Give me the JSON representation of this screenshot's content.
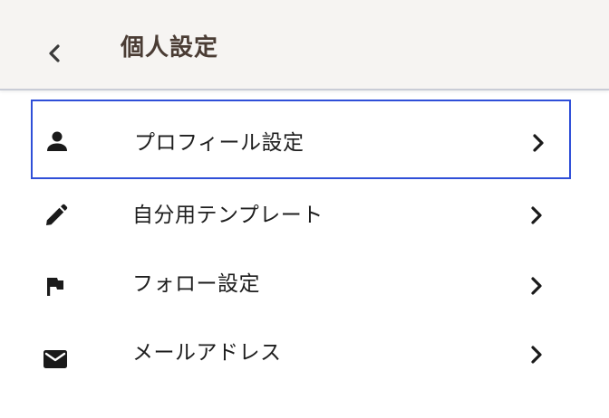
{
  "header": {
    "title": "個人設定",
    "back_icon": "chevron-left-icon"
  },
  "menu": {
    "items": [
      {
        "label": "プロフィール設定",
        "icon": "person-icon",
        "selected": true
      },
      {
        "label": "自分用テンプレート",
        "icon": "pencil-icon",
        "selected": false
      },
      {
        "label": "フォロー設定",
        "icon": "flag-icon",
        "selected": false
      },
      {
        "label": "メールアドレス",
        "icon": "mail-icon",
        "selected": false
      }
    ]
  },
  "colors": {
    "header_bg": "#f6f4f2",
    "title_text": "#4a3c34",
    "selection_border": "#2f4fd8",
    "icon": "#1a1a1a"
  }
}
